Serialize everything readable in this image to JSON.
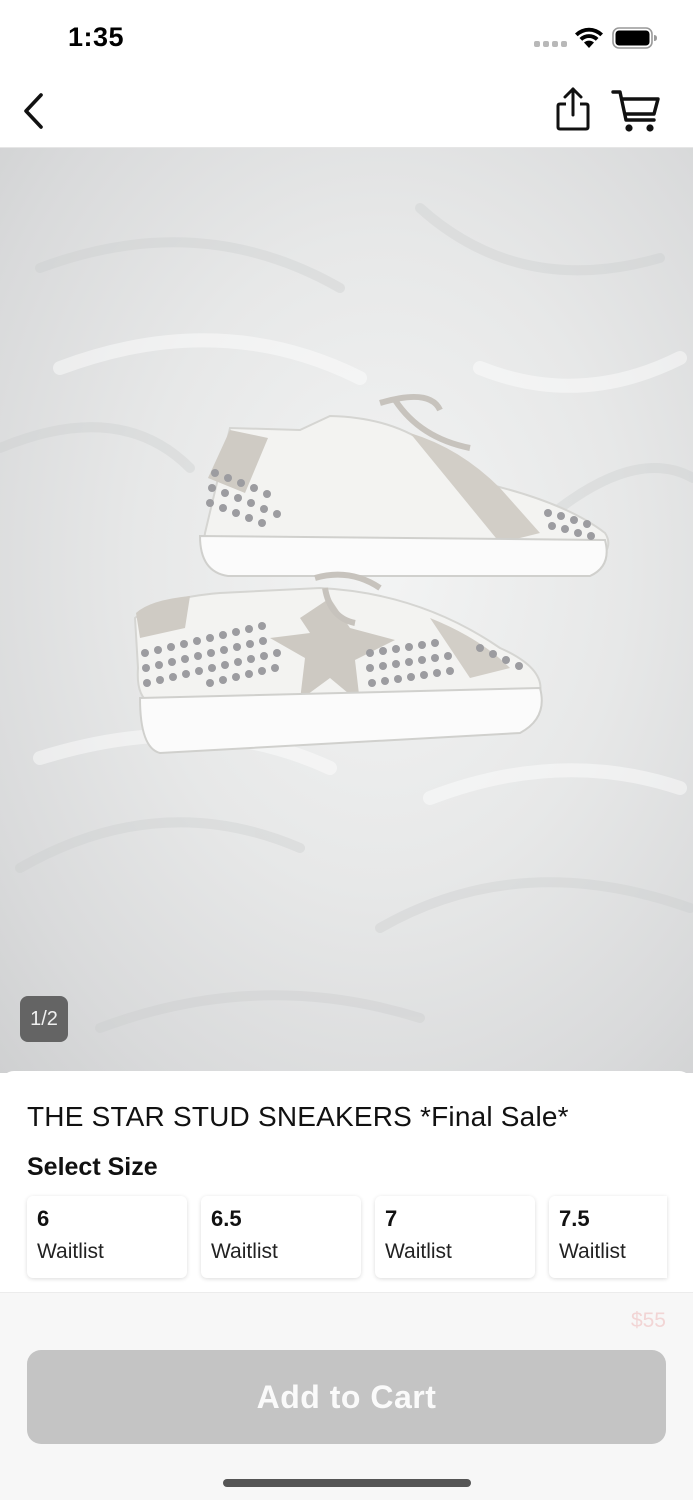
{
  "status_bar": {
    "time": "1:35",
    "signal_icon": "cellular-signal-icon",
    "wifi_icon": "wifi-icon",
    "battery_icon": "battery-icon"
  },
  "nav": {
    "back_icon": "chevron-left-icon",
    "share_icon": "share-icon",
    "cart_icon": "cart-icon"
  },
  "gallery": {
    "page_indicator": "1/2"
  },
  "product": {
    "title": "THE STAR STUD SNEAKERS *Final Sale*",
    "size_heading": "Select Size",
    "sizes": [
      {
        "size": "6",
        "status": "Waitlist"
      },
      {
        "size": "6.5",
        "status": "Waitlist"
      },
      {
        "size": "7",
        "status": "Waitlist"
      },
      {
        "size": "7.5",
        "status": "Waitlist"
      }
    ]
  },
  "footer": {
    "price": "$55",
    "add_to_cart_label": "Add to Cart"
  },
  "colors": {
    "button_disabled": "#c4c4c4",
    "price_text": "#f2d5d5",
    "background": "#ffffff"
  }
}
